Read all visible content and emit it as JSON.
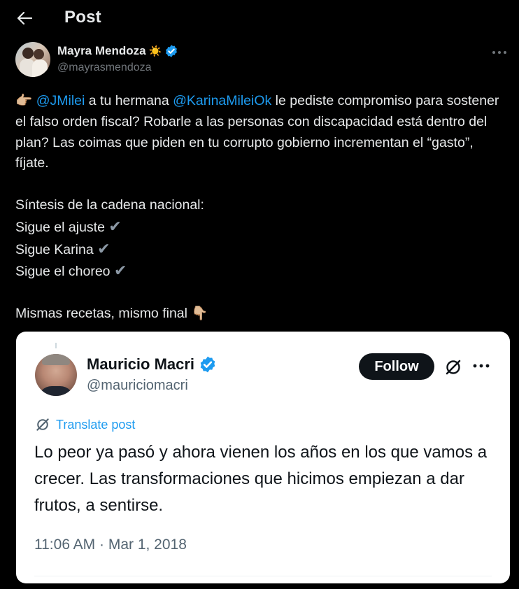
{
  "header": {
    "title": "Post"
  },
  "author": {
    "name": "Mayra Mendoza",
    "name_emoji": "☀️",
    "handle": "@mayrasmendoza"
  },
  "tweet": {
    "pointer_emoji": "👉🏼",
    "mention1": "@JMilei",
    "text1": " a tu hermana ",
    "mention2": "@KarinaMileiOk",
    "text2": " le pediste compromiso para sostener el falso orden fiscal? Robarle a las personas con discapacidad está dentro del plan? Las coimas que piden en tu corrupto gobierno incrementan el “gasto”, fíjate.",
    "line_summary": "Síntesis de la cadena nacional:",
    "line_a": "Sigue el ajuste",
    "line_b": "Sigue Karina",
    "line_c": "Sigue el choreo",
    "check_mark": "✔",
    "closing": "Mismas recetas, mismo final",
    "closing_emoji": "👇🏼"
  },
  "quote": {
    "name": "Mauricio Macri",
    "handle": "@mauriciomacri",
    "follow_label": "Follow",
    "translate_label": "Translate post",
    "text": "Lo peor ya pasó y ahora vienen los años en los que vamos a crecer. Las transformaciones que hicimos empiezan a dar frutos, a sentirse.",
    "timestamp": "11:06 AM · Mar 1, 2018"
  },
  "colors": {
    "accent": "#1d9bf0",
    "background": "#000000",
    "card": "#ffffff",
    "verified": "#1d9bf0"
  },
  "icons": {
    "back": "arrow-left-icon",
    "verified": "verified-badge-icon",
    "more": "more-horizontal-icon",
    "grok": "grok-icon",
    "translate": "translate-icon"
  }
}
